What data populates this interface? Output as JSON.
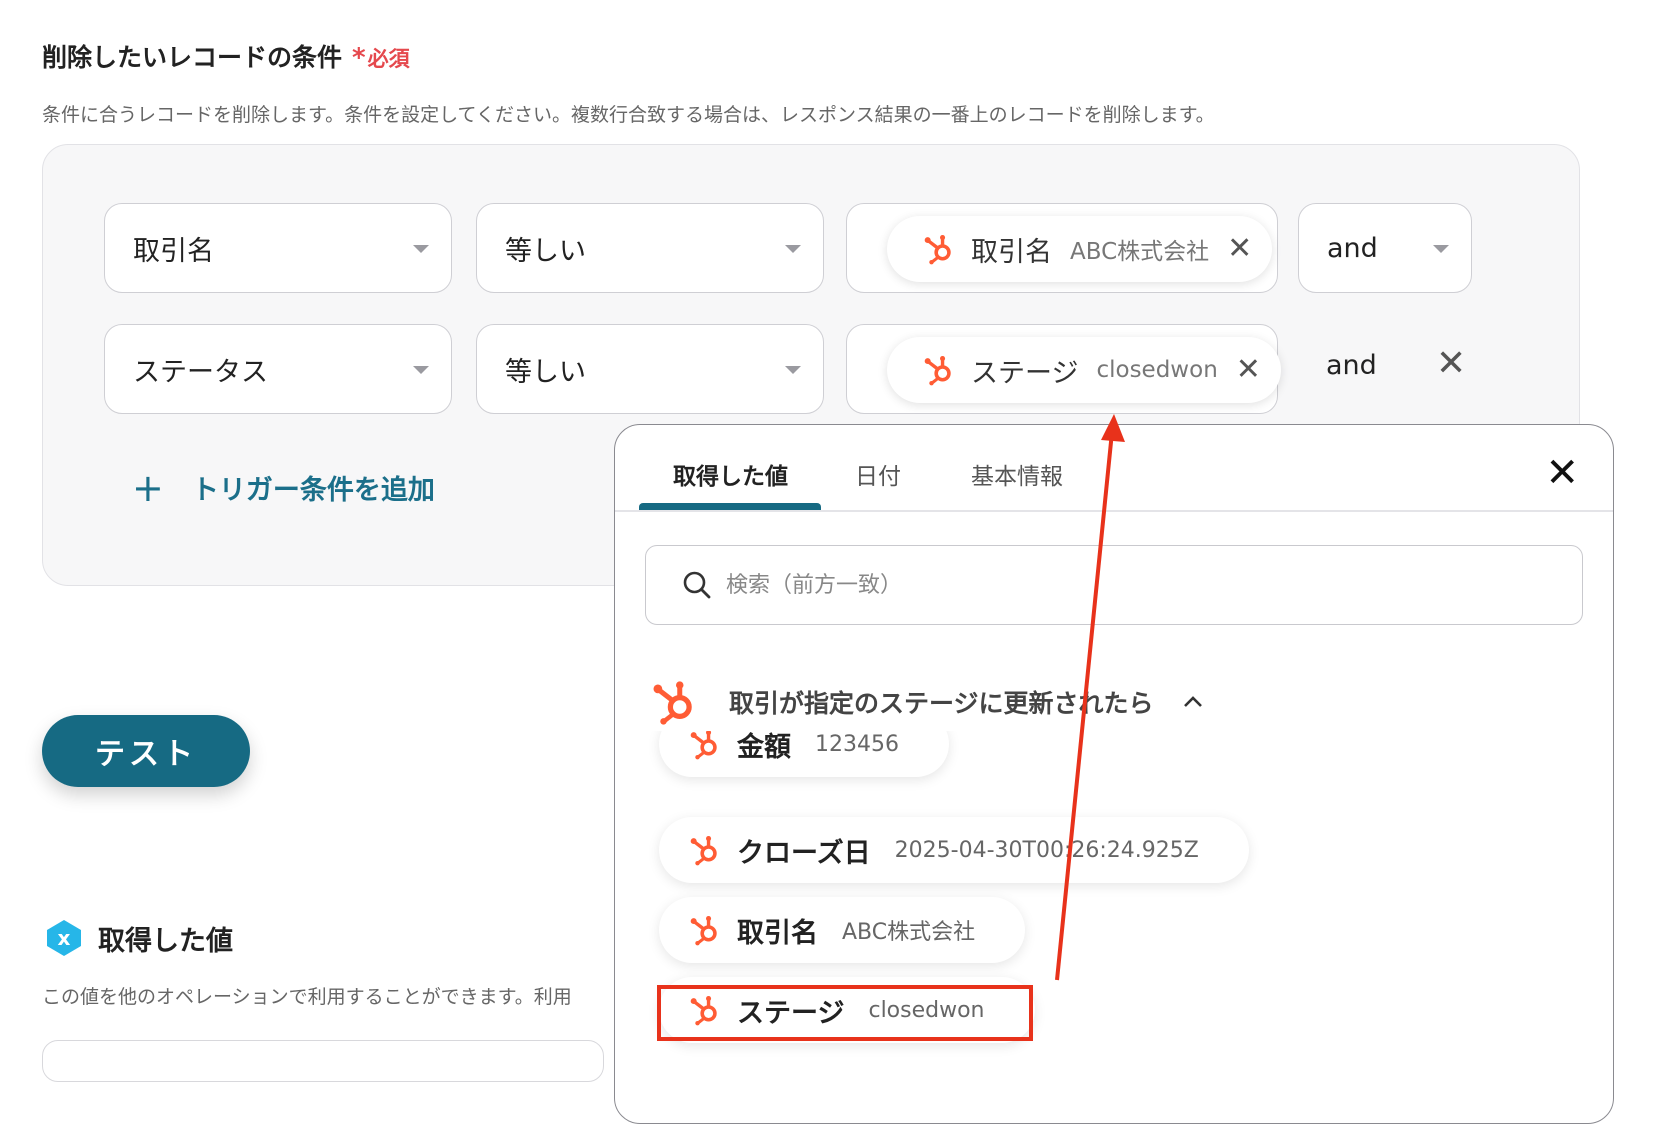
{
  "section": {
    "title": "削除したいレコードの条件",
    "required_star": "*",
    "required_label": "必須",
    "description": "条件に合うレコードを削除します。条件を設定してください。複数行合致する場合は、レスポンス結果の一番上のレコードを削除します。"
  },
  "conditions": [
    {
      "field": "取引名",
      "operator": "等しい",
      "value_label": "取引名",
      "value_text": "ABC株式会社",
      "conjunction": "and"
    },
    {
      "field": "ステータス",
      "operator": "等しい",
      "value_label": "ステージ",
      "value_text": "closedwon",
      "conjunction": "and"
    }
  ],
  "add_condition_label": "トリガー条件を追加",
  "test_button_label": "テスト",
  "retrieved": {
    "title": "取得した値",
    "badge": "x",
    "description": "この値を他のオペレーションで利用することができます。利用"
  },
  "panel": {
    "tabs": [
      {
        "label": "取得した値",
        "active": true
      },
      {
        "label": "日付",
        "active": false
      },
      {
        "label": "基本情報",
        "active": false
      }
    ],
    "search_placeholder": "検索（前方一致）",
    "group_title": "取引が指定のステージに更新されたら",
    "items": [
      {
        "label": "金額",
        "value": "123456"
      },
      {
        "label": "クローズ日",
        "value": "2025-04-30T00:26:24.925Z"
      },
      {
        "label": "取引名",
        "value": "ABC株式会社"
      },
      {
        "label": "ステージ",
        "value": "closedwon"
      }
    ]
  },
  "icons": {
    "hubspot": "hubspot-sprocket-icon",
    "remove": "close-icon",
    "dropdown": "caret-down-icon",
    "search": "search-icon",
    "collapse": "chevron-up-icon"
  },
  "colors": {
    "hubspot_orange": "#ff5c35",
    "brand_teal": "#166a83",
    "required_red": "#e5484d",
    "annotation_red": "#e8321b"
  }
}
